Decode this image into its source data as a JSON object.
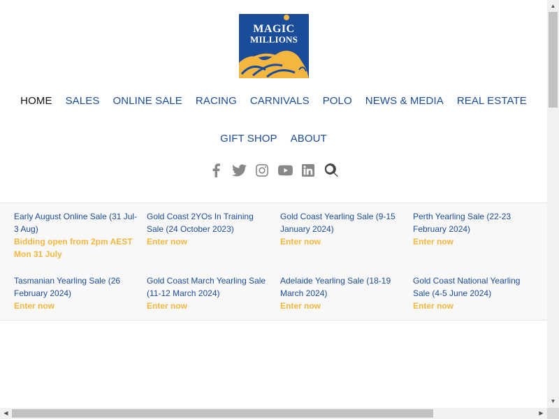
{
  "logo": {
    "line1": "MAGIC",
    "line2": "MILLIONS",
    "colors": {
      "bg": "#1b4c9a",
      "accent": "#f4b63f"
    }
  },
  "nav": {
    "row1": [
      "HOME",
      "SALES",
      "ONLINE SALE",
      "RACING",
      "CARNIVALS",
      "POLO",
      "NEWS & MEDIA",
      "REAL ESTATE"
    ],
    "row2": [
      "GIFT SHOP",
      "ABOUT"
    ],
    "active": "HOME"
  },
  "social": [
    "facebook-icon",
    "twitter-icon",
    "instagram-icon",
    "youtube-icon",
    "linkedin-icon",
    "search-icon"
  ],
  "sales": [
    {
      "title": "Early August Online Sale (31 Jul-3 Aug)",
      "cta": "Bidding open from 2pm AEST Mon 31 July"
    },
    {
      "title": "Gold Coast 2YOs In Training Sale (24 October 2023)",
      "cta": "Enter now"
    },
    {
      "title": "Gold Coast Yearling Sale (9-15 January 2024)",
      "cta": "Enter now"
    },
    {
      "title": "Perth Yearling Sale (22-23 February 2024)",
      "cta": "Enter now"
    },
    {
      "title": "Tasmanian Yearling Sale (26 February 2024)",
      "cta": "Enter now"
    },
    {
      "title": "Gold Coast March Yearling Sale (11-12 March 2024)",
      "cta": "Enter now"
    },
    {
      "title": "Adelaide Yearling Sale (18-19 March 2024)",
      "cta": "Enter now"
    },
    {
      "title": "Gold Coast National Yearling Sale (4-5 June 2024)",
      "cta": "Enter now"
    }
  ],
  "colors": {
    "link": "#1b4c9a",
    "cta": "#f4b63f",
    "band": "#f8f8f8"
  }
}
